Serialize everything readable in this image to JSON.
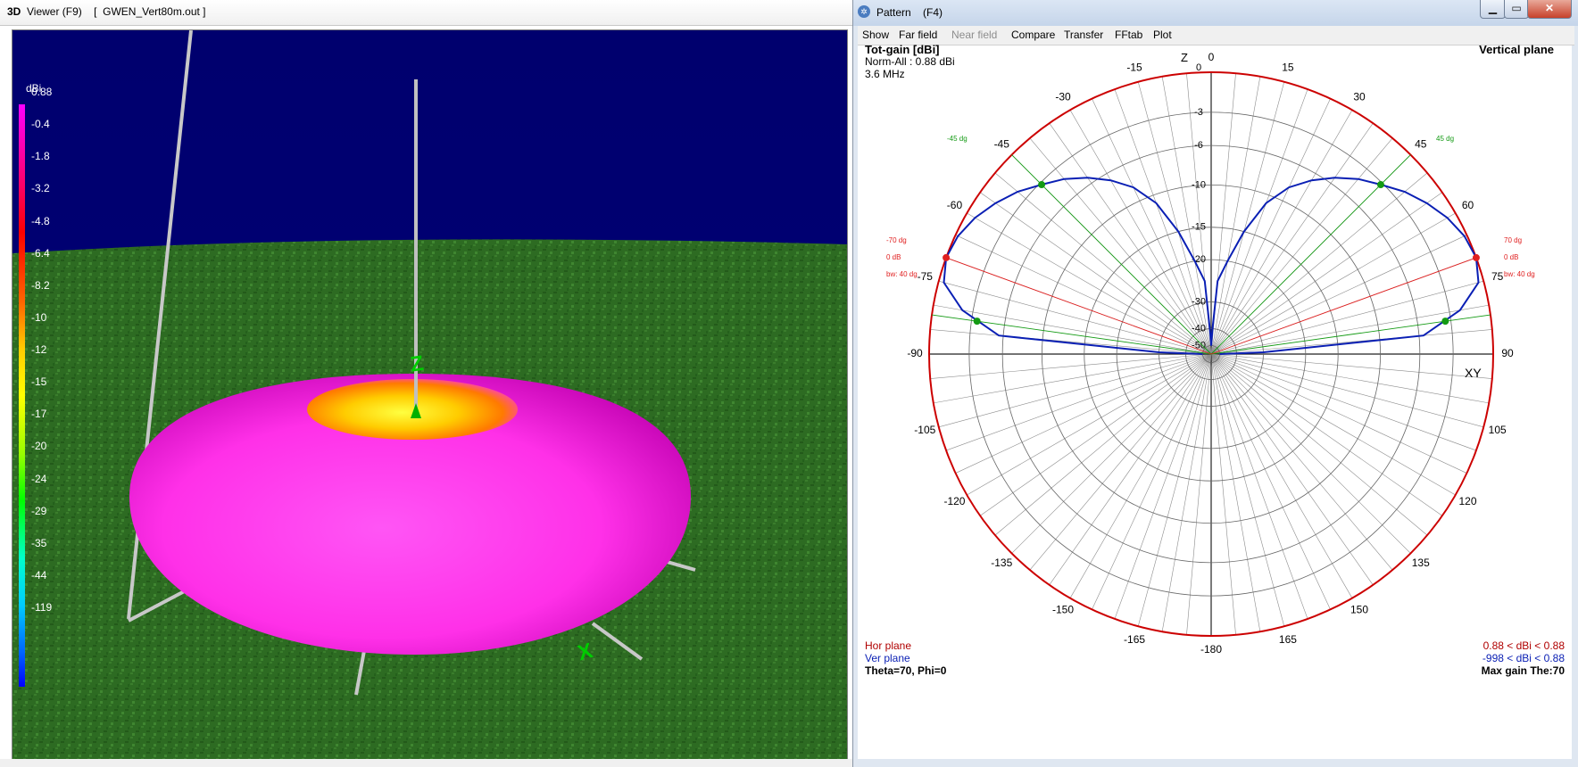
{
  "viewer": {
    "title_icon": "3D",
    "title": "Viewer (F9)    [  GWEN_Vert80m.out ]",
    "colorbar": {
      "unit": "dBi",
      "ticks": [
        "0.88",
        "-0.4",
        "-1.8",
        "-3.2",
        "-4.8",
        "-6.4",
        "-8.2",
        "-10",
        "-12",
        "-15",
        "-17",
        "-20",
        "-24",
        "-29",
        "-35",
        "-44",
        "-119"
      ]
    },
    "axis_labels": {
      "z": "Z",
      "x": "X"
    },
    "colors": {
      "sky": "#00006e",
      "ground": "#2d6b22",
      "pattern": "#ff3cf0"
    }
  },
  "pattern": {
    "title": "Pattern    (F4)",
    "menu": [
      {
        "label": "Show",
        "enabled": true
      },
      {
        "label": "Far field",
        "enabled": true
      },
      {
        "label": "Near field",
        "enabled": false
      },
      {
        "label": "Compare",
        "enabled": true
      },
      {
        "label": "Transfer",
        "enabled": true
      },
      {
        "label": "FFtab",
        "enabled": true
      },
      {
        "label": "Plot",
        "enabled": true
      }
    ],
    "plot": {
      "header_title": "Tot-gain [dBi]",
      "norm": "Norm-All : 0.88 dBi",
      "freq": "3.6 MHz",
      "plane_title": "Vertical plane",
      "z_label": "Z",
      "xy_label": "XY",
      "angle_labels": [
        "0",
        "15",
        "30",
        "45",
        "60",
        "75",
        "90",
        "105",
        "120",
        "135",
        "150",
        "165",
        "-180",
        "-165",
        "-150",
        "-135",
        "-120",
        "-105",
        "-90",
        "-75",
        "-60",
        "-45",
        "-30",
        "-15"
      ],
      "ring_labels": [
        "0",
        "-3",
        "-6",
        "-10",
        "-15",
        "-20",
        "-30",
        "-40",
        "-50"
      ],
      "marker_labels": {
        "left_45": "-45 dg",
        "right_45": "45 dg",
        "left_70": "-70 dg",
        "right_70": "70 dg",
        "zero_db": "0 dB",
        "bw": "bw: 40 dg"
      },
      "legend": {
        "hor": "Hor plane",
        "ver": "Ver plane",
        "hor_range": "0.88 < dBi < 0.88",
        "ver_range": "-998 < dBi < 0.88",
        "theta_phi": "Theta=70, Phi=0",
        "max_gain": "Max gain The:70"
      },
      "colors": {
        "outer_circle": "#cc0000",
        "pattern_line": "#0a1fb4",
        "marker_green": "#139a13",
        "marker_red": "#e02020",
        "grid": "#555555"
      }
    },
    "chart_data": {
      "type": "line",
      "title": "Tot-gain [dBi]",
      "subtitle": "Vertical plane",
      "radial_scale_dbi_rel": [
        0,
        -3,
        -6,
        -10,
        -15,
        -20,
        -30,
        -40,
        -50
      ],
      "series": [
        {
          "name": "Ver plane",
          "theta_deg": [
            0,
            3,
            5,
            10,
            15,
            20,
            25,
            30,
            35,
            40,
            45,
            50,
            55,
            60,
            65,
            70,
            75,
            80,
            85,
            88,
            90
          ],
          "gain_rel_db": [
            -50,
            -40,
            -25,
            -20,
            -15,
            -11,
            -8.5,
            -6.8,
            -5.4,
            -4.2,
            -3.2,
            -2.2,
            -1.4,
            -0.7,
            -0.2,
            0,
            -0.4,
            -2.2,
            -5.6,
            -30,
            -50
          ]
        }
      ],
      "markers": [
        {
          "theta_deg": 45,
          "label": "45 dg"
        },
        {
          "theta_deg": 70,
          "label": "70 dg",
          "gain_rel_db": 0
        },
        {
          "theta_deg": 82,
          "label": ""
        }
      ]
    }
  }
}
